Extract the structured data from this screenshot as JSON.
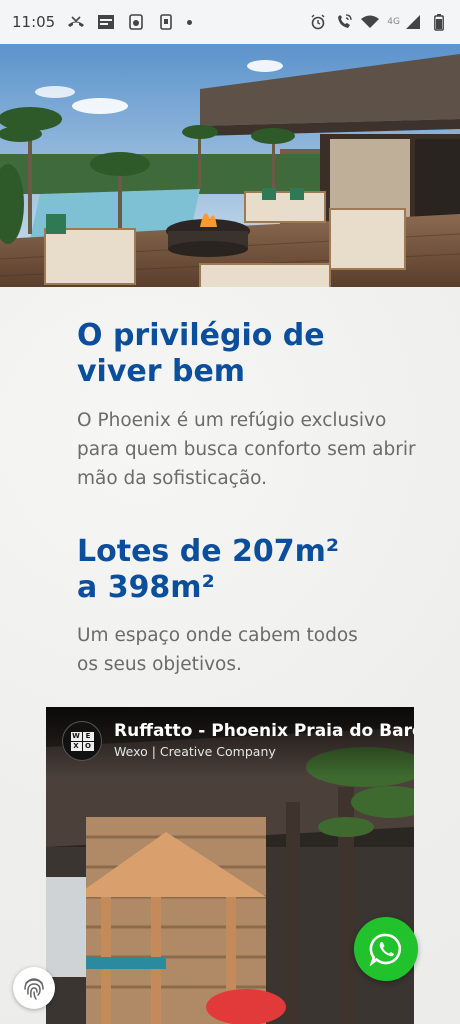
{
  "status_bar": {
    "time": "11:05",
    "network_label": "4G",
    "left_icons": [
      "missed-call-icon",
      "news-icon",
      "dashboard-icon",
      "phone-icon",
      "dot-icon"
    ],
    "right_icons": [
      "alarm-icon",
      "wifi-call-icon",
      "wifi-icon",
      "signal-icon",
      "battery-icon"
    ]
  },
  "hero": {
    "image": "resort-pool-deck-icon"
  },
  "section1": {
    "heading": "O privilégio de viver bem",
    "text": "O Phoenix é um refúgio exclusivo para quem busca conforto sem abrir mão da sofisticação."
  },
  "section2": {
    "heading": "Lotes de 207m²\n a 398m²",
    "text": "Um espaço onde cabem todos os seus objetivos."
  },
  "video": {
    "title": "Ruffatto - Phoenix Praia do Barco",
    "channel": "Wexo | Creative Company",
    "logo_letters": [
      "W",
      "E",
      "X",
      "O"
    ]
  },
  "floating": {
    "whatsapp_icon": "whatsapp-icon",
    "fingerprint_icon": "fingerprint-icon"
  },
  "colors": {
    "heading": "#0b4f9c",
    "body_text": "#6b6b6b",
    "whatsapp": "#22c22d",
    "background": "#f1f1ef"
  }
}
